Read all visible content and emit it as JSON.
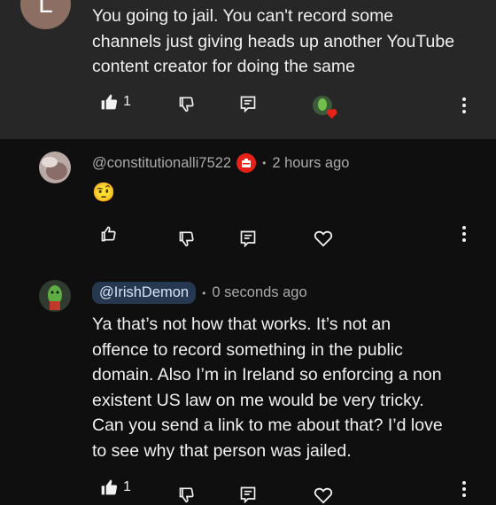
{
  "comments": [
    {
      "avatar_letter": "L",
      "text": "You going to jail. You can't record some\nchannels just giving heads up another YouTube\ncontent creator for doing the same",
      "like_count": "1"
    },
    {
      "handle": "@constitutionalli7522",
      "time": "2 hours ago",
      "emoji": "🤨"
    },
    {
      "handle": "@IrishDemon",
      "time": "0 seconds ago",
      "text": "Ya that’s not how that works. It’s not an\noffence to record something in the public\ndomain. Also I’m in Ireland so enforcing a non\nexistent US law on me would be very tricky.\nCan you send a link to me about that? I’d love\nto see why that person was jailed.",
      "like_count": "1"
    }
  ],
  "colors": {
    "card_bg": "#272727",
    "page_bg": "#0f0f0f",
    "heart_red": "#e62117",
    "handle_pill": "#263850"
  }
}
